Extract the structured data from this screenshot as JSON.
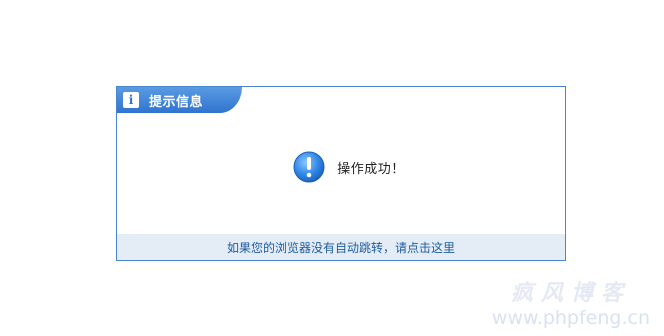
{
  "dialog": {
    "title": "提示信息",
    "info_icon": "info-icon",
    "message": "操作成功！",
    "message_icon": "exclamation-circle-icon",
    "redirect_link": "如果您的浏览器没有自动跳转，请点击这里"
  },
  "watermark": {
    "title": "疯风博客",
    "url": "www.phpfeng.cn"
  },
  "colors": {
    "accent": "#2f74cf",
    "border": "#4a86cf",
    "footer_bg": "#e4ecf6",
    "link": "#1f5da0"
  }
}
